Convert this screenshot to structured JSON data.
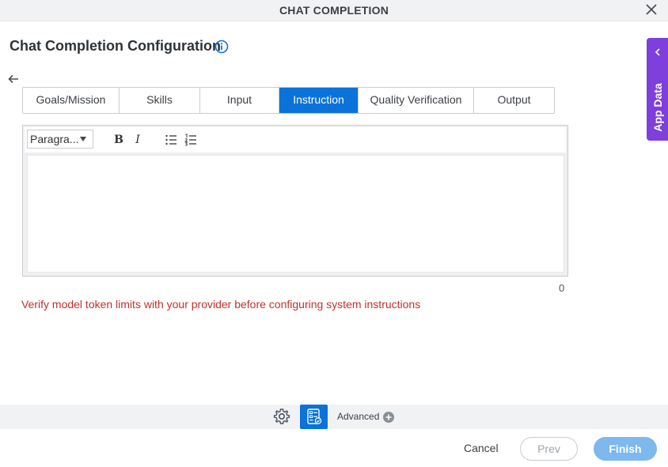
{
  "window": {
    "title": "CHAT COMPLETION"
  },
  "header": {
    "title": "Chat Completion Configuration"
  },
  "tabs": [
    {
      "label": "Goals/Mission"
    },
    {
      "label": "Skills"
    },
    {
      "label": "Input"
    },
    {
      "label": "Instruction",
      "active": true
    },
    {
      "label": "Quality Verification"
    },
    {
      "label": "Output"
    }
  ],
  "editor": {
    "paragraph_select": "Paragra...",
    "bold_label": "B",
    "italic_label": "I",
    "value": "",
    "char_count": "0"
  },
  "warning": "Verify model token limits with your provider before configuring system instructions",
  "footer": {
    "advanced_label": "Advanced",
    "cancel_label": "Cancel",
    "prev_label": "Prev",
    "finish_label": "Finish"
  },
  "side_panel": {
    "label": "App Data"
  },
  "colors": {
    "accent": "#0a72d9",
    "side_panel": "#7e3fdc",
    "warning": "#c0312b",
    "finish_disabled": "#7db8ee"
  },
  "icons": [
    "close-icon",
    "info-icon",
    "back-arrow-icon",
    "bullet-list-icon",
    "numbered-list-icon",
    "gear-icon",
    "form-icon",
    "plus-circle-icon",
    "chevron-left-icon"
  ]
}
